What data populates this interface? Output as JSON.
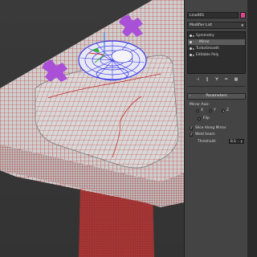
{
  "viewport": {
    "shell_color": "#cfcfcf",
    "wire_color": "#c41f1f",
    "gizmo_color": "#a94fd8",
    "selection_color": "#3a3ae8"
  },
  "panel": {
    "object_name": "Line001",
    "object_color": "#e0458f",
    "modifier_list_label": "Modifier List",
    "stack": [
      {
        "label": "Symmetry",
        "selected": false,
        "sub": false
      },
      {
        "label": "Mirror",
        "selected": true,
        "sub": true
      },
      {
        "label": "TurboSmooth",
        "selected": false,
        "sub": false
      },
      {
        "label": "Editable Poly",
        "selected": false,
        "sub": false
      }
    ],
    "tools": [
      "⊣",
      "‖",
      "∀",
      "✏",
      "▦"
    ],
    "rollout_title": "Parameters",
    "rollout_sign": "-",
    "mirror_axis_label": "Mirror Axis:",
    "axes": [
      {
        "label": "X",
        "selected": false
      },
      {
        "label": "Y",
        "selected": false
      },
      {
        "label": "Z",
        "selected": true
      }
    ],
    "flip_label": "Flip",
    "flip_checked": false,
    "slice_label": "Slice Along Mirror",
    "slice_checked": true,
    "weld_label": "Weld Seam",
    "weld_checked": true,
    "threshold_label": "Threshold:",
    "threshold_value": "0.1"
  }
}
